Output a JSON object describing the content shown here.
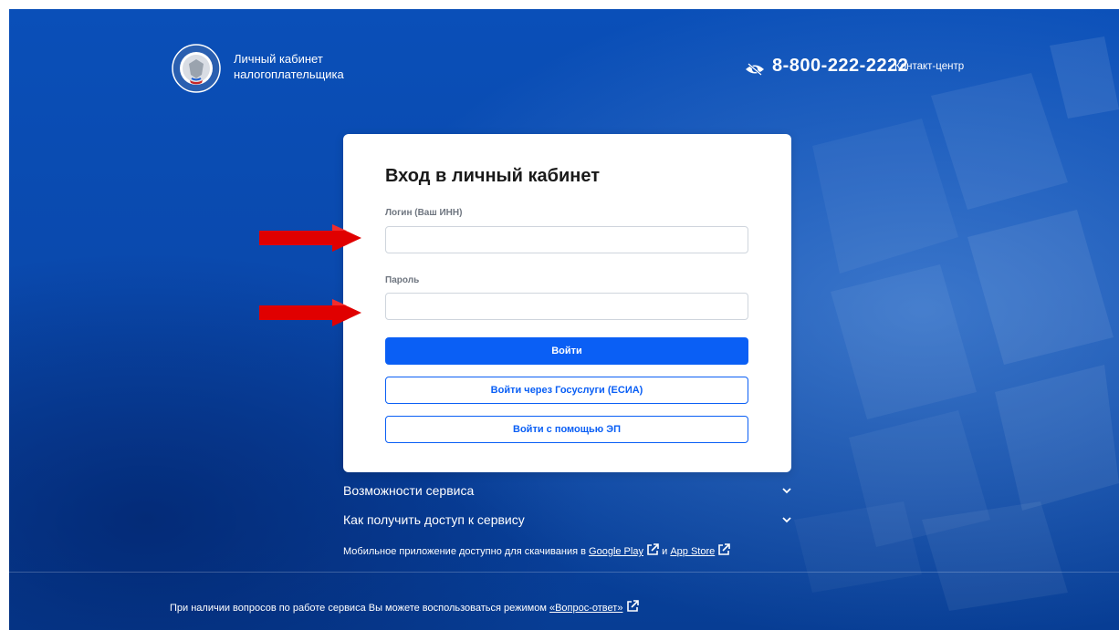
{
  "header": {
    "title_line1": "Личный кабинет",
    "title_line2": "налогоплательщика",
    "phone": "8-800-222-2222",
    "contact_label": "Контакт-центр"
  },
  "login": {
    "title": "Вход в личный кабинет",
    "login_label": "Логин (Ваш ИНН)",
    "login_value": "",
    "password_label": "Пароль",
    "password_value": "",
    "submit_label": "Войти",
    "esia_label": "Войти через Госуслуги (ЕСИА)",
    "ep_label": "Войти с помощью ЭП"
  },
  "info": {
    "features_label": "Возможности сервиса",
    "access_label": "Как получить доступ к сервису",
    "mobile_prefix": "Мобильное приложение доступно для скачивания в",
    "google_play": "Google Play",
    "and": "и",
    "app_store": "App Store"
  },
  "footer": {
    "text": "При наличии вопросов по работе сервиса Вы можете воспользоваться режимом",
    "faq_link": "«Вопрос-ответ»"
  },
  "colors": {
    "background": "#0a4fb8",
    "primary_button": "#0a5ff5",
    "annotation_arrow": "#e00000"
  },
  "icons": [
    "fns-emblem-icon",
    "eye-crossed-icon",
    "chevron-down-icon",
    "external-link-icon",
    "red-arrow-icon"
  ]
}
